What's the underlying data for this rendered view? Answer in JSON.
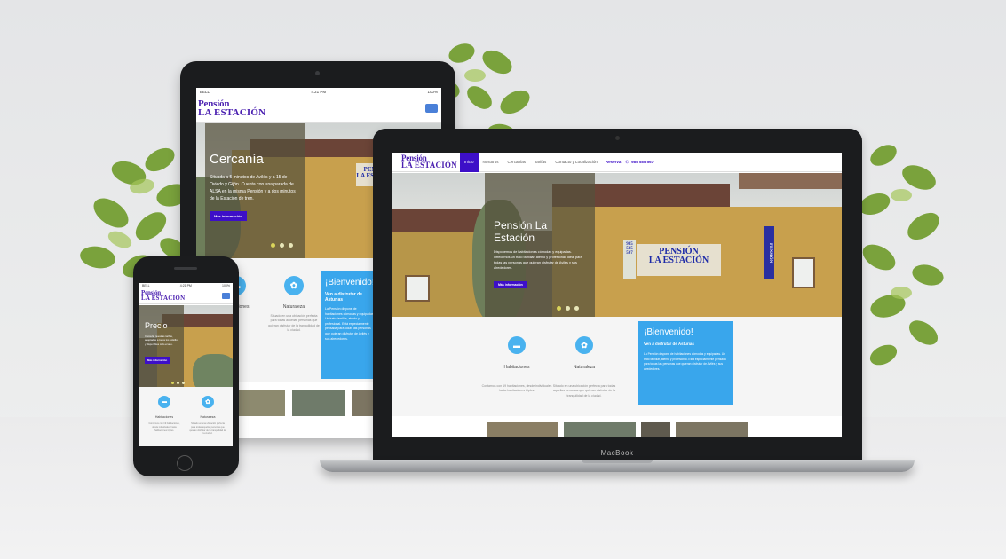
{
  "site": {
    "logo_line1": "Pensión",
    "logo_line2": "LA ESTACIÓN",
    "nav": [
      "Inicio",
      "Nosotros",
      "Cercanías",
      "Tarifas",
      "Contacto y Localización"
    ],
    "reserva_label": "Reserva",
    "phone": "985 585 567",
    "more_button": "Más información",
    "welcome_title": "¡Bienvenido!",
    "welcome_subtitle": "Ven a disfrutar de Asturias",
    "welcome_text": "La Pensión dispone de habitaciones cómodas y equipadas. Un trato familiar, atento y profesional. Está especialmente pensada para todas las personas que quieran disfrutar de Avilés y sus alrededores.",
    "features": [
      {
        "title": "Habitaciones",
        "icon": "bed-icon",
        "text": "Contamos con 19 habitaciones, desde individuales hasta habitaciones triples."
      },
      {
        "title": "Naturaleza",
        "icon": "leaf-icon",
        "text": "Situado en una ubicación perfecta para todas aquellas personas que quieran disfrutar de la tranquilidad de la ciudad."
      }
    ],
    "accent": "#3d0fc8",
    "feature_blue": "#49b2ef"
  },
  "laptop": {
    "brand": "MacBook",
    "slide_title": "Pensión La Estación",
    "slide_text": "Disponemos de habitaciones cómodas y equipadas. Ofrecemos un trato familiar, atento y profesional, ideal para todas las personas que quieran disfrutar de Avilés y sus alrededores.",
    "sign_line1": "PENSIÓN",
    "sign_line2": "LA ESTACIÓN",
    "sign_phone": "985 585 567"
  },
  "tablet": {
    "carrier": "BELL",
    "time": "4:21 PM",
    "battery": "100%",
    "slide_title": "Cercanía",
    "slide_text": "Situada a 5 minutos de Avilés y a 15 de Oviedo y Gijón. Cuenta con una parada de ALSA en la misma Pensión y a dos minutos de la Estación de tren."
  },
  "phone": {
    "carrier": "BELL",
    "time": "4:21 PM",
    "battery": "100%",
    "slide_title": "Precio",
    "slide_text": "Consulte nuestras tarifas, adaptadas a todos los bolsillos y disponibles todo el año."
  }
}
